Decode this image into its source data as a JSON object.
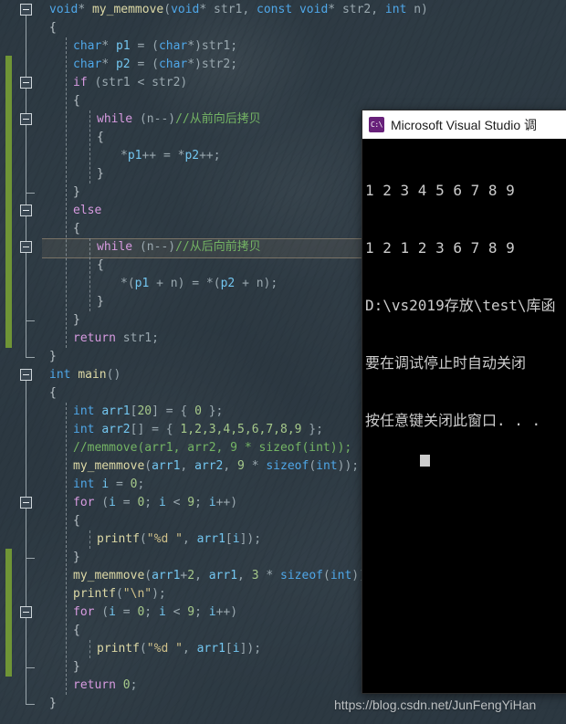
{
  "app": {
    "name": "Visual Studio code editor",
    "background_color": "#2f3c47"
  },
  "editor": {
    "current_line_index": 13,
    "change_bar_color": "#6f9536",
    "lines": [
      {
        "i": 0,
        "indent": 0,
        "tokens": [
          {
            "t": "void",
            "c": "type"
          },
          {
            "t": "* ",
            "c": "pun"
          },
          {
            "t": "my_memmove",
            "c": "fn"
          },
          {
            "t": "(",
            "c": "pun"
          },
          {
            "t": "void",
            "c": "type"
          },
          {
            "t": "* str1, ",
            "c": "pun"
          },
          {
            "t": "const",
            "c": "type"
          },
          {
            "t": " ",
            "c": "pun"
          },
          {
            "t": "void",
            "c": "type"
          },
          {
            "t": "* str2, ",
            "c": "pun"
          },
          {
            "t": "int",
            "c": "type"
          },
          {
            "t": " n)",
            "c": "pun"
          }
        ]
      },
      {
        "i": 1,
        "indent": 0,
        "tokens": [
          {
            "t": "{",
            "c": "brc"
          }
        ]
      },
      {
        "i": 2,
        "indent": 1,
        "tokens": [
          {
            "t": "char",
            "c": "type"
          },
          {
            "t": "* ",
            "c": "pun"
          },
          {
            "t": "p1",
            "c": "var"
          },
          {
            "t": " = (",
            "c": "pun"
          },
          {
            "t": "char",
            "c": "type"
          },
          {
            "t": "*)str1;",
            "c": "pun"
          }
        ]
      },
      {
        "i": 3,
        "indent": 1,
        "tokens": [
          {
            "t": "char",
            "c": "type"
          },
          {
            "t": "* ",
            "c": "pun"
          },
          {
            "t": "p2",
            "c": "var"
          },
          {
            "t": " = (",
            "c": "pun"
          },
          {
            "t": "char",
            "c": "type"
          },
          {
            "t": "*)str2;",
            "c": "pun"
          }
        ]
      },
      {
        "i": 4,
        "indent": 1,
        "tokens": [
          {
            "t": "if",
            "c": "kw"
          },
          {
            "t": " (str1 < str2)",
            "c": "pun"
          }
        ]
      },
      {
        "i": 5,
        "indent": 1,
        "tokens": [
          {
            "t": "{",
            "c": "brc"
          }
        ]
      },
      {
        "i": 6,
        "indent": 2,
        "tokens": [
          {
            "t": "while",
            "c": "kw"
          },
          {
            "t": " (n--)",
            "c": "pun"
          },
          {
            "t": "//从前向后拷贝",
            "c": "cmt"
          }
        ]
      },
      {
        "i": 7,
        "indent": 2,
        "tokens": [
          {
            "t": "{",
            "c": "brc"
          }
        ]
      },
      {
        "i": 8,
        "indent": 3,
        "tokens": [
          {
            "t": "*",
            "c": "pun"
          },
          {
            "t": "p1",
            "c": "var"
          },
          {
            "t": "++ = *",
            "c": "pun"
          },
          {
            "t": "p2",
            "c": "var"
          },
          {
            "t": "++;",
            "c": "pun"
          }
        ]
      },
      {
        "i": 9,
        "indent": 2,
        "tokens": [
          {
            "t": "}",
            "c": "brc"
          }
        ]
      },
      {
        "i": 10,
        "indent": 1,
        "tokens": [
          {
            "t": "}",
            "c": "brc"
          }
        ]
      },
      {
        "i": 11,
        "indent": 1,
        "tokens": [
          {
            "t": "else",
            "c": "kw"
          }
        ]
      },
      {
        "i": 12,
        "indent": 1,
        "tokens": [
          {
            "t": "{",
            "c": "brc"
          }
        ]
      },
      {
        "i": 13,
        "indent": 2,
        "tokens": [
          {
            "t": "while",
            "c": "kw"
          },
          {
            "t": " (n--)",
            "c": "pun"
          },
          {
            "t": "//从后向前拷贝",
            "c": "cmt"
          }
        ]
      },
      {
        "i": 14,
        "indent": 2,
        "tokens": [
          {
            "t": "{",
            "c": "brc"
          }
        ]
      },
      {
        "i": 15,
        "indent": 3,
        "tokens": [
          {
            "t": "*(",
            "c": "pun"
          },
          {
            "t": "p1",
            "c": "var"
          },
          {
            "t": " + n) = *(",
            "c": "pun"
          },
          {
            "t": "p2",
            "c": "var"
          },
          {
            "t": " + n);",
            "c": "pun"
          }
        ]
      },
      {
        "i": 16,
        "indent": 2,
        "tokens": [
          {
            "t": "}",
            "c": "brc"
          }
        ]
      },
      {
        "i": 17,
        "indent": 1,
        "tokens": [
          {
            "t": "}",
            "c": "brc"
          }
        ]
      },
      {
        "i": 18,
        "indent": 1,
        "tokens": [
          {
            "t": "return",
            "c": "kw"
          },
          {
            "t": " str1;",
            "c": "pun"
          }
        ]
      },
      {
        "i": 19,
        "indent": 0,
        "tokens": [
          {
            "t": "}",
            "c": "brc"
          }
        ]
      },
      {
        "i": 20,
        "indent": 0,
        "tokens": [
          {
            "t": "int",
            "c": "type"
          },
          {
            "t": " ",
            "c": "pun"
          },
          {
            "t": "main",
            "c": "fn"
          },
          {
            "t": "()",
            "c": "pun"
          }
        ]
      },
      {
        "i": 21,
        "indent": 0,
        "tokens": [
          {
            "t": "{",
            "c": "brc"
          }
        ]
      },
      {
        "i": 22,
        "indent": 1,
        "tokens": [
          {
            "t": "int",
            "c": "type"
          },
          {
            "t": " ",
            "c": "pun"
          },
          {
            "t": "arr1",
            "c": "var"
          },
          {
            "t": "[",
            "c": "pun"
          },
          {
            "t": "20",
            "c": "num"
          },
          {
            "t": "] = { ",
            "c": "pun"
          },
          {
            "t": "0",
            "c": "num"
          },
          {
            "t": " };",
            "c": "pun"
          }
        ]
      },
      {
        "i": 23,
        "indent": 1,
        "tokens": [
          {
            "t": "int",
            "c": "type"
          },
          {
            "t": " ",
            "c": "pun"
          },
          {
            "t": "arr2",
            "c": "var"
          },
          {
            "t": "[] = { ",
            "c": "pun"
          },
          {
            "t": "1,2,3,4,5,6,7,8,9",
            "c": "num"
          },
          {
            "t": " };",
            "c": "pun"
          }
        ]
      },
      {
        "i": 24,
        "indent": 1,
        "tokens": [
          {
            "t": "//memmove(arr1, arr2, 9 * sizeof(int));",
            "c": "cmt"
          }
        ]
      },
      {
        "i": 25,
        "indent": 1,
        "tokens": [
          {
            "t": "my_memmove",
            "c": "fn"
          },
          {
            "t": "(",
            "c": "pun"
          },
          {
            "t": "arr1",
            "c": "var"
          },
          {
            "t": ", ",
            "c": "pun"
          },
          {
            "t": "arr2",
            "c": "var"
          },
          {
            "t": ", ",
            "c": "pun"
          },
          {
            "t": "9",
            "c": "num"
          },
          {
            "t": " * ",
            "c": "pun"
          },
          {
            "t": "sizeof",
            "c": "type"
          },
          {
            "t": "(",
            "c": "pun"
          },
          {
            "t": "int",
            "c": "type"
          },
          {
            "t": "));",
            "c": "pun"
          }
        ]
      },
      {
        "i": 26,
        "indent": 1,
        "tokens": [
          {
            "t": "int",
            "c": "type"
          },
          {
            "t": " ",
            "c": "pun"
          },
          {
            "t": "i",
            "c": "var"
          },
          {
            "t": " = ",
            "c": "pun"
          },
          {
            "t": "0",
            "c": "num"
          },
          {
            "t": ";",
            "c": "pun"
          }
        ]
      },
      {
        "i": 27,
        "indent": 1,
        "tokens": [
          {
            "t": "for",
            "c": "kw"
          },
          {
            "t": " (",
            "c": "pun"
          },
          {
            "t": "i",
            "c": "var"
          },
          {
            "t": " = ",
            "c": "pun"
          },
          {
            "t": "0",
            "c": "num"
          },
          {
            "t": "; ",
            "c": "pun"
          },
          {
            "t": "i",
            "c": "var"
          },
          {
            "t": " < ",
            "c": "pun"
          },
          {
            "t": "9",
            "c": "num"
          },
          {
            "t": "; ",
            "c": "pun"
          },
          {
            "t": "i",
            "c": "var"
          },
          {
            "t": "++)",
            "c": "pun"
          }
        ]
      },
      {
        "i": 28,
        "indent": 1,
        "tokens": [
          {
            "t": "{",
            "c": "brc"
          }
        ]
      },
      {
        "i": 29,
        "indent": 2,
        "tokens": [
          {
            "t": "printf",
            "c": "fn"
          },
          {
            "t": "(",
            "c": "pun"
          },
          {
            "t": "\"%d \"",
            "c": "str"
          },
          {
            "t": ", ",
            "c": "pun"
          },
          {
            "t": "arr1",
            "c": "var"
          },
          {
            "t": "[",
            "c": "pun"
          },
          {
            "t": "i",
            "c": "var"
          },
          {
            "t": "]);",
            "c": "pun"
          }
        ]
      },
      {
        "i": 30,
        "indent": 1,
        "tokens": [
          {
            "t": "}",
            "c": "brc"
          }
        ]
      },
      {
        "i": 31,
        "indent": 1,
        "tokens": [
          {
            "t": "my_memmove",
            "c": "fn"
          },
          {
            "t": "(",
            "c": "pun"
          },
          {
            "t": "arr1",
            "c": "var"
          },
          {
            "t": "+",
            "c": "pun"
          },
          {
            "t": "2",
            "c": "num"
          },
          {
            "t": ", ",
            "c": "pun"
          },
          {
            "t": "arr1",
            "c": "var"
          },
          {
            "t": ", ",
            "c": "pun"
          },
          {
            "t": "3",
            "c": "num"
          },
          {
            "t": " * ",
            "c": "pun"
          },
          {
            "t": "sizeof",
            "c": "type"
          },
          {
            "t": "(",
            "c": "pun"
          },
          {
            "t": "int",
            "c": "type"
          },
          {
            "t": "));",
            "c": "pun"
          }
        ]
      },
      {
        "i": 32,
        "indent": 1,
        "tokens": [
          {
            "t": "printf",
            "c": "fn"
          },
          {
            "t": "(",
            "c": "pun"
          },
          {
            "t": "\"\\n\"",
            "c": "str"
          },
          {
            "t": ");",
            "c": "pun"
          }
        ]
      },
      {
        "i": 33,
        "indent": 1,
        "tokens": [
          {
            "t": "for",
            "c": "kw"
          },
          {
            "t": " (",
            "c": "pun"
          },
          {
            "t": "i",
            "c": "var"
          },
          {
            "t": " = ",
            "c": "pun"
          },
          {
            "t": "0",
            "c": "num"
          },
          {
            "t": "; ",
            "c": "pun"
          },
          {
            "t": "i",
            "c": "var"
          },
          {
            "t": " < ",
            "c": "pun"
          },
          {
            "t": "9",
            "c": "num"
          },
          {
            "t": "; ",
            "c": "pun"
          },
          {
            "t": "i",
            "c": "var"
          },
          {
            "t": "++)",
            "c": "pun"
          }
        ]
      },
      {
        "i": 34,
        "indent": 1,
        "tokens": [
          {
            "t": "{",
            "c": "brc"
          }
        ]
      },
      {
        "i": 35,
        "indent": 2,
        "tokens": [
          {
            "t": "printf",
            "c": "fn"
          },
          {
            "t": "(",
            "c": "pun"
          },
          {
            "t": "\"%d \"",
            "c": "str"
          },
          {
            "t": ", ",
            "c": "pun"
          },
          {
            "t": "arr1",
            "c": "var"
          },
          {
            "t": "[",
            "c": "pun"
          },
          {
            "t": "i",
            "c": "var"
          },
          {
            "t": "]);",
            "c": "pun"
          }
        ]
      },
      {
        "i": 36,
        "indent": 1,
        "tokens": [
          {
            "t": "}",
            "c": "brc"
          }
        ]
      },
      {
        "i": 37,
        "indent": 1,
        "tokens": [
          {
            "t": "return",
            "c": "kw"
          },
          {
            "t": " ",
            "c": "pun"
          },
          {
            "t": "0",
            "c": "num"
          },
          {
            "t": ";",
            "c": "pun"
          }
        ]
      },
      {
        "i": 38,
        "indent": 0,
        "tokens": [
          {
            "t": "}",
            "c": "brc"
          }
        ]
      }
    ],
    "outline_boxes_lines": [
      0,
      4,
      6,
      11,
      13,
      20,
      27,
      33
    ],
    "change_bars": [
      {
        "from_line": 3,
        "to_line": 18
      },
      {
        "from_line": 30,
        "to_line": 36
      }
    ]
  },
  "console": {
    "title": "Microsoft Visual Studio 调",
    "icon": "cmd-console-icon",
    "icon_glyph": "C:\\",
    "lines": [
      "1 2 3 4 5 6 7 8 9",
      "1 2 1 2 3 6 7 8 9",
      "D:\\vs2019存放\\test\\库函",
      "要在调试停止时自动关闭",
      "按任意键关闭此窗口. . ."
    ]
  },
  "watermark": {
    "text": "https://blog.csdn.net/JunFengYiHan"
  }
}
